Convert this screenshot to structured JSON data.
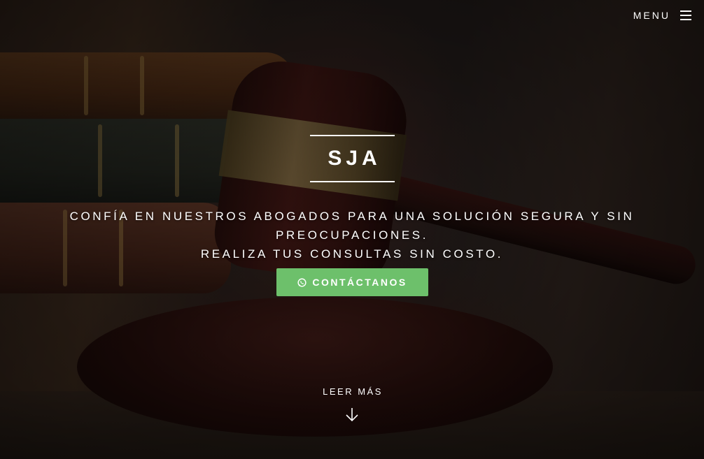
{
  "header": {
    "menu_label": "MENU",
    "menu_icon": "hamburger-icon"
  },
  "hero": {
    "brand": "SJA",
    "tagline_line1": "CONFÍA EN NUESTROS ABOGADOS PARA UNA SOLUCIÓN SEGURA Y SIN PREOCUPACIONES.",
    "tagline_line2": "REALIZA TUS CONSULTAS SIN COSTO.",
    "cta_label": "CONTÁCTANOS",
    "cta_icon": "whatsapp-icon",
    "more_label": "LEER MÁS",
    "more_icon": "arrow-down-icon"
  },
  "colors": {
    "cta_background": "#6dc06b",
    "text": "#ffffff"
  }
}
